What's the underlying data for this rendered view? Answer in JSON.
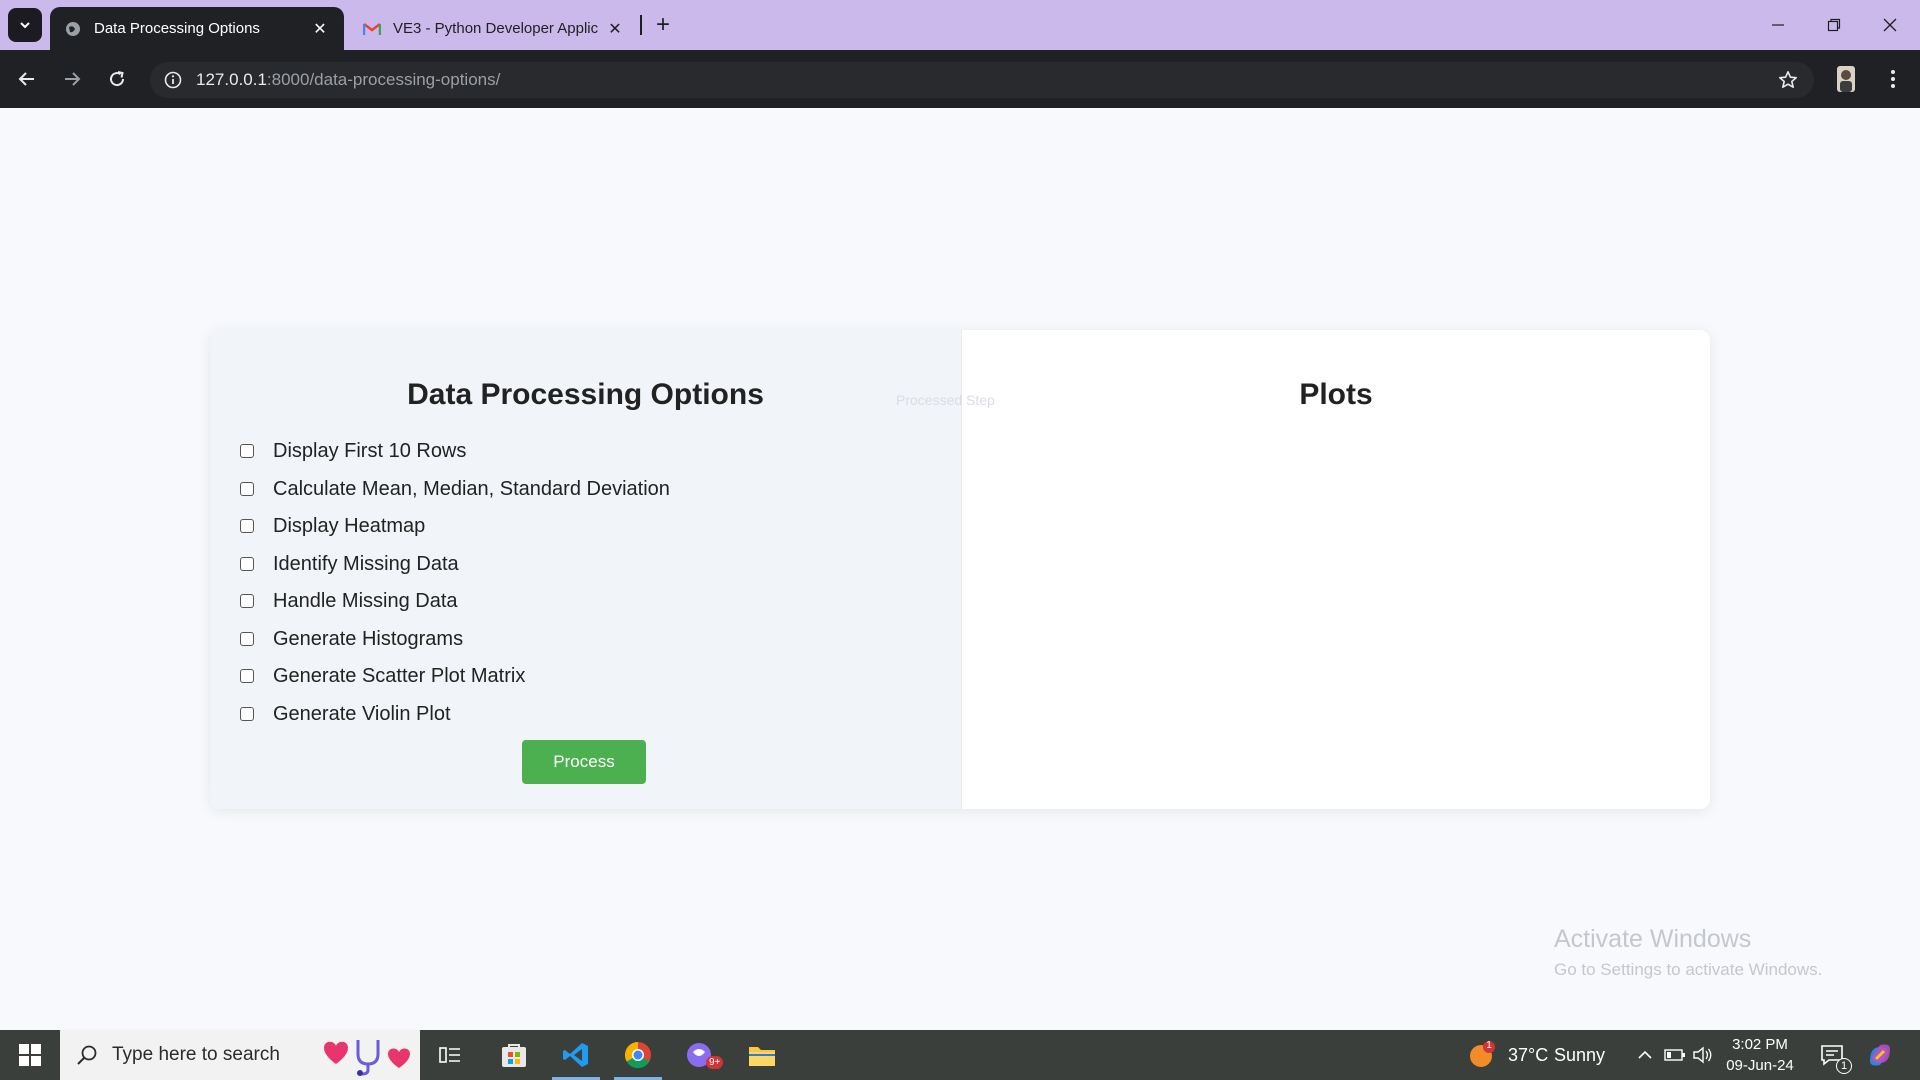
{
  "browser": {
    "tabs": [
      {
        "title": "Data Processing Options",
        "active": true,
        "favicon": "globe-icon"
      },
      {
        "title": "VE3 - Python Developer Applic",
        "active": false,
        "favicon": "gmail-icon"
      }
    ],
    "new_tab_label": "+",
    "url": {
      "host": "127.0.0.1",
      "rest": ":8000/data-processing-options/"
    }
  },
  "page": {
    "left_title": "Data Processing Options",
    "right_title": "Plots",
    "options": [
      {
        "label": "Display First 10 Rows",
        "checked": false
      },
      {
        "label": "Calculate Mean, Median, Standard Deviation",
        "checked": false
      },
      {
        "label": "Display Heatmap",
        "checked": false
      },
      {
        "label": "Identify Missing Data",
        "checked": false
      },
      {
        "label": "Handle Missing Data",
        "checked": false
      },
      {
        "label": "Generate Histograms",
        "checked": false
      },
      {
        "label": "Generate Scatter Plot Matrix",
        "checked": false
      },
      {
        "label": "Generate Violin Plot",
        "checked": false
      }
    ],
    "process_label": "Process",
    "ghost_text": "Processed Step",
    "accent_color": "#4caf50"
  },
  "watermark": {
    "line1": "Activate Windows",
    "line2": "Go to Settings to activate Windows."
  },
  "taskbar": {
    "search_placeholder": "Type here to search",
    "weather": {
      "temp": "37°C",
      "condition": "Sunny",
      "badge": "1"
    },
    "clock": {
      "time": "3:02 PM",
      "date": "09-Jun-24"
    },
    "notification_count": "1",
    "chat_badge": "9+"
  }
}
